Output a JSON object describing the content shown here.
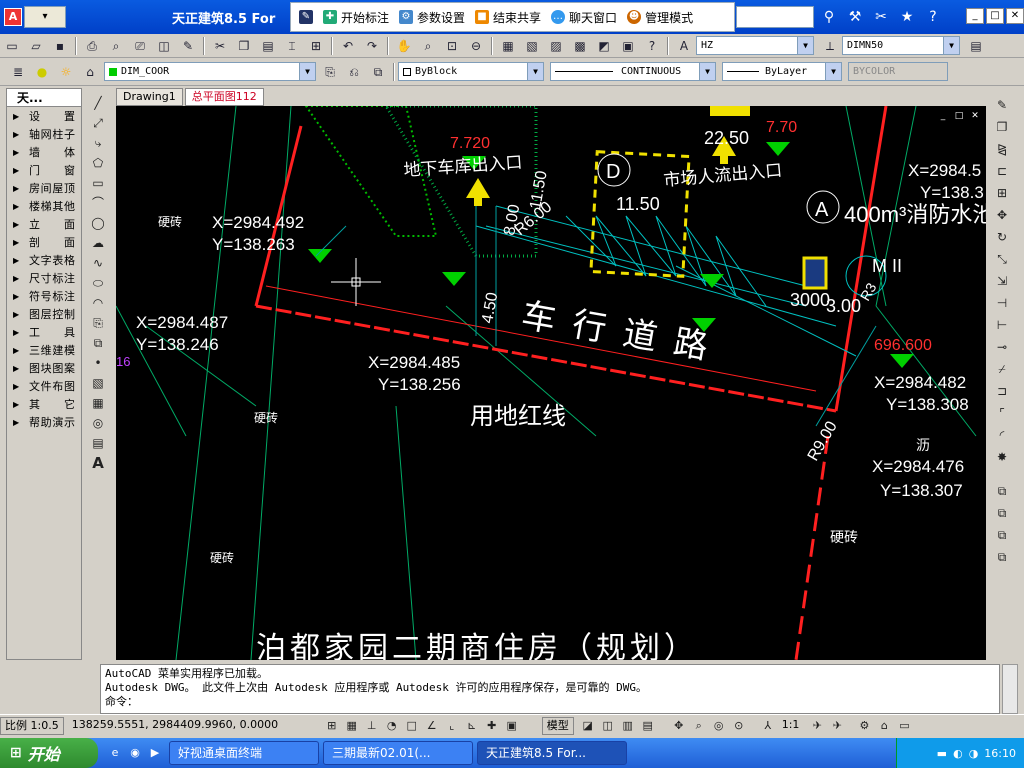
{
  "window": {
    "title": "天正建筑8.5 For",
    "app_icon": "A",
    "app_menu": "▾"
  },
  "share_toolbar": {
    "items": [
      {
        "label": "",
        "icon": "pen-icon"
      },
      {
        "label": "开始标注",
        "icon": "annotate-icon"
      },
      {
        "label": "参数设置",
        "icon": "settings-icon"
      },
      {
        "label": "结束共享",
        "icon": "stop-share-icon"
      },
      {
        "label": "聊天窗口",
        "icon": "chat-icon"
      },
      {
        "label": "管理模式",
        "icon": "admin-icon"
      }
    ]
  },
  "toolbar2": {
    "text_style": "HZ",
    "dim_style": "DIMN50",
    "layer": "DIM_COOR",
    "color": "ByBlock",
    "linetype": "CONTINUOUS",
    "lineweight": "ByLayer",
    "plotstyle": "BYCOLOR"
  },
  "tz_panel": {
    "title": "天...",
    "items": [
      "设　置",
      "轴网柱子",
      "墙　体",
      "门　窗",
      "房间屋顶",
      "楼梯其他",
      "立　面",
      "剖　面",
      "文字表格",
      "尺寸标注",
      "符号标注",
      "图层控制",
      "工　具",
      "三维建模",
      "图块图案",
      "文件布图",
      "其　它",
      "帮助演示"
    ]
  },
  "tabs": [
    "Drawing1",
    "总平面图112"
  ],
  "drawing": {
    "labels": {
      "coord1_x": "X=2984.492",
      "coord1_y": "Y=138.263",
      "coord2_x": "X=2984.487",
      "coord2_y": "Y=138.246",
      "coord3_x": "X=2984.485",
      "coord3_y": "Y=138.256",
      "coord4_x": "X=2984.482",
      "coord4_y": "Y=138.308",
      "coord5_x": "X=2984.476",
      "coord5_y": "Y=138.307",
      "coord6_x": "X=2984.5",
      "coord6_y": "Y=138.3",
      "road": "车 行 道 路",
      "redline": "用地红线",
      "parking": "地下车库出入口",
      "market": "市场人流出入口",
      "fire_pool": "400m³消防水池",
      "circle_a": "A",
      "circle_d": "D",
      "dim_1150": "11.50",
      "dim_2250": "22.50",
      "dim_770": "7.70",
      "dim_7720": "7.720",
      "dim_3000": "3000",
      "dim_300": "3.00",
      "dim_450": "4.50",
      "dim_800": "8.00",
      "dim_1150b": "11.50",
      "dim_r600": "R6.00",
      "dim_r900": "R9.00",
      "dim_rc": "R3",
      "elev_696": "696.600",
      "hard1": "硬砖",
      "hard2": "硬砖",
      "hard3": "硬砖",
      "hard4": "硬砖",
      "asphalt": "沥",
      "bottom_title": "泊都家园二期商住房（规划）",
      "side_mark": "16",
      "mark_m": "M II"
    }
  },
  "command": {
    "line1": "AutoCAD 菜单实用程序已加载。",
    "line2": "Autodesk DWG。  此文件上次由 Autodesk 应用程序或 Autodesk 许可的应用程序保存，是可靠的 DWG。",
    "prompt": "命令："
  },
  "statusbar": {
    "scale": "比例 1:0.5",
    "coords": "138259.5551, 2984409.9960, 0.0000",
    "model": "模型",
    "anno_scale": "1:1"
  },
  "taskbar": {
    "start": "开始",
    "tasks": [
      "好视通桌面终端",
      "三期最新02.01(...",
      "天正建筑8.5 For..."
    ],
    "clock": "16:10"
  },
  "colors": {
    "canvas_bg": "#000000",
    "road_line": "#ff2020",
    "green_marker": "#00d000",
    "yellow": "#f0e000",
    "cyan": "#00c0c0"
  }
}
